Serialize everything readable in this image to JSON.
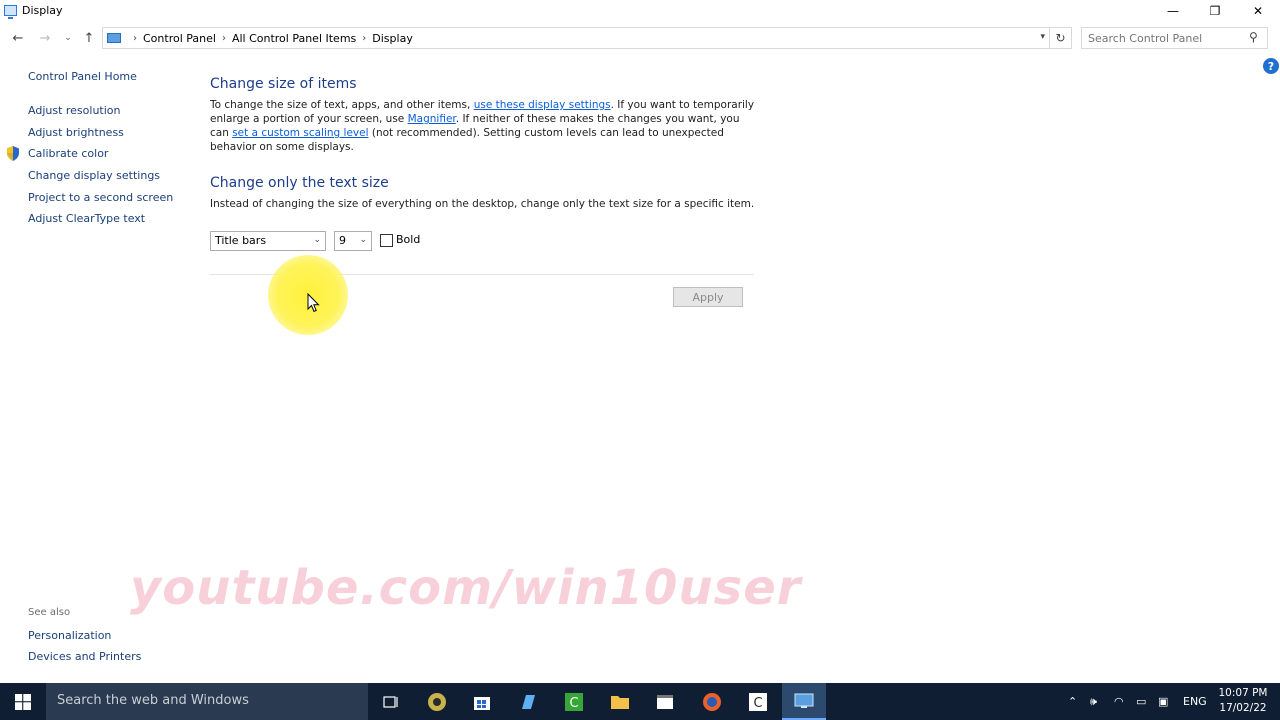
{
  "window": {
    "title": "Display",
    "controls": {
      "minimize": "—",
      "maximize": "❐",
      "close": "✕"
    }
  },
  "nav": {
    "back": "←",
    "forward": "→",
    "recent": "⌄",
    "up": "↑",
    "breadcrumbs": [
      "Control Panel",
      "All Control Panel Items",
      "Display"
    ],
    "separator": "›",
    "refresh": "↻",
    "search_placeholder": "Search Control Panel",
    "help": "?"
  },
  "left_pane": {
    "home": "Control Panel Home",
    "items": [
      "Adjust resolution",
      "Adjust brightness",
      "Calibrate color",
      "Change display settings",
      "Project to a second screen",
      "Adjust ClearType text"
    ],
    "see_also_label": "See also",
    "see_also": [
      "Personalization",
      "Devices and Printers"
    ]
  },
  "main": {
    "section1": {
      "heading": "Change size of items",
      "text_1": "To change the size of text, apps, and other items, ",
      "link_1": "use these display settings",
      "text_2": ". If you want to temporarily enlarge a portion of your screen, use ",
      "link_2": "Magnifier",
      "text_3": ". If neither of these makes the changes you want, you can ",
      "link_3": "set a custom scaling level",
      "text_4": " (not recommended). Setting custom levels can lead to unexpected behavior on some displays."
    },
    "section2": {
      "heading": "Change only the text size",
      "text": "Instead of changing the size of everything on the desktop, change only the text size for a specific item."
    },
    "item_select": "Title bars",
    "size_select": "9",
    "bold_label": "Bold",
    "bold_checked": false,
    "apply_label": "Apply"
  },
  "watermark": "youtube.com/win10user",
  "taskbar": {
    "search_placeholder": "Search the web and Windows",
    "language": "ENG",
    "time": "10:07 PM",
    "date": "17/02/22"
  },
  "colors": {
    "link": "#0b5ed8",
    "heading": "#1e3e8a",
    "nav_link": "#1a3f7a",
    "taskbar": "#0f1e33"
  }
}
